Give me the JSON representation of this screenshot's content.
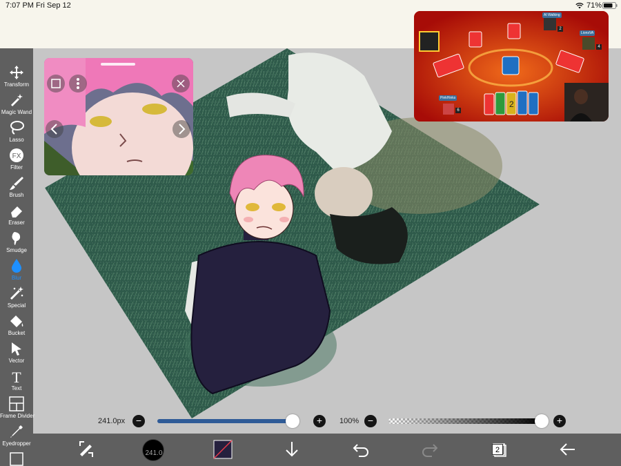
{
  "status_bar": {
    "time": "7:07 PM",
    "date": "Fri Sep 12",
    "battery_percent": "71%",
    "icons": [
      "wifi-icon",
      "battery-icon"
    ]
  },
  "toolbar": {
    "tools": [
      {
        "id": "transform",
        "label": "Transform",
        "icon": "move-arrows-icon"
      },
      {
        "id": "magic-wand",
        "label": "Magic Wand",
        "icon": "magic-wand-icon"
      },
      {
        "id": "lasso",
        "label": "Lasso",
        "icon": "lasso-icon"
      },
      {
        "id": "filter",
        "label": "Filter",
        "icon": "fx-icon"
      },
      {
        "id": "brush",
        "label": "Brush",
        "icon": "brush-icon"
      },
      {
        "id": "eraser",
        "label": "Eraser",
        "icon": "eraser-icon"
      },
      {
        "id": "smudge",
        "label": "Smudge",
        "icon": "smudge-icon"
      },
      {
        "id": "blur",
        "label": "Blur",
        "icon": "droplet-icon",
        "active": true
      },
      {
        "id": "special",
        "label": "Special",
        "icon": "sparkle-pen-icon"
      },
      {
        "id": "bucket",
        "label": "Bucket",
        "icon": "paint-bucket-icon"
      },
      {
        "id": "vector",
        "label": "Vector",
        "icon": "cursor-arrow-icon"
      },
      {
        "id": "text",
        "label": "Text",
        "icon": "text-t-icon"
      },
      {
        "id": "frame-divider",
        "label": "Frame Divider",
        "icon": "frame-divider-icon"
      },
      {
        "id": "eyedropper",
        "label": "Eyedropper",
        "icon": "eyedropper-icon"
      }
    ],
    "fx_glyph": "FX",
    "text_glyph": "T"
  },
  "sliders": {
    "brush_size": "241.0px",
    "brush_size_fraction": 0.97,
    "opacity": "100%",
    "opacity_fraction": 1.0,
    "minus": "−",
    "plus": "+"
  },
  "bottom_bar": {
    "color_value": "241.0",
    "layers_count": "2",
    "icons": [
      "adjust-tools-icon",
      "color-circle",
      "secondary-color-swatch",
      "download-arrow-icon",
      "undo-icon",
      "redo-icon",
      "layers-icon",
      "back-arrow-icon"
    ]
  },
  "pip_game": {
    "players": [
      "AI Walking",
      "LionsVA",
      "PinkHinks"
    ],
    "counts": [
      "2",
      "4",
      "6"
    ],
    "center_card": "2"
  },
  "colors": {
    "accent": "#1e90ff",
    "toolbar_bg": "#5f5f5f",
    "header_bg": "#f7f5ec",
    "slider_fill": "#2f5b97"
  }
}
